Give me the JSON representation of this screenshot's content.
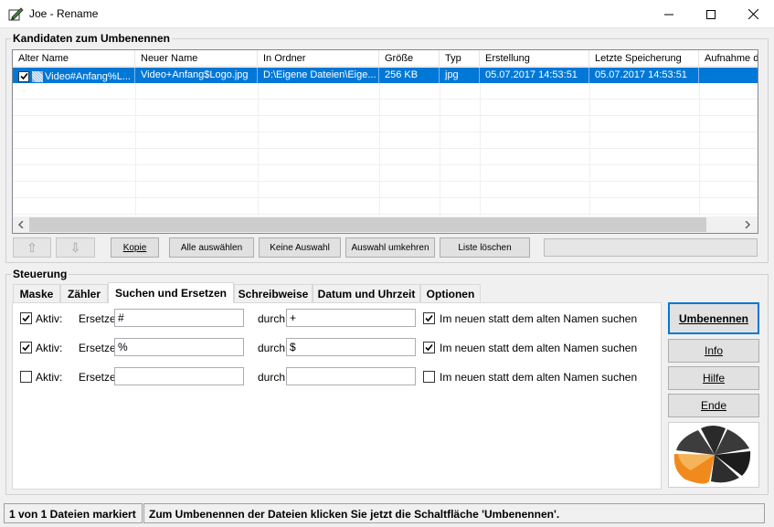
{
  "window": {
    "title": "Joe - Rename"
  },
  "candidates": {
    "group_label": "Kandidaten zum Umbenennen",
    "columns": [
      "Alter Name",
      "Neuer Name",
      "In Ordner",
      "Größe",
      "Typ",
      "Erstellung",
      "Letzte Speicherung",
      "Aufnahme d"
    ],
    "rows": [
      {
        "checked": true,
        "old_name": "Video#Anfang%L...",
        "new_name": "Video+Anfang$Logo.jpg",
        "folder": "D:\\Eigene Dateien\\Eige...",
        "size": "256 KB",
        "type": "jpg",
        "created": "05.07.2017 14:53:51",
        "modified": "05.07.2017 14:53:51",
        "taken": ""
      }
    ]
  },
  "list_buttons": {
    "up": "⇧",
    "down": "⇩",
    "copy": "Kopie",
    "select_all": "Alle auswählen",
    "select_none": "Keine Auswahl",
    "invert": "Auswahl umkehren",
    "clear_list": "Liste löschen"
  },
  "control": {
    "group_label": "Steuerung",
    "tabs": [
      "Maske",
      "Zähler",
      "Suchen und Ersetzen",
      "Schreibweise",
      "Datum und Uhrzeit",
      "Optionen"
    ],
    "active_tab": "Suchen und Ersetzen",
    "rules": [
      {
        "active": true,
        "active_label": "Aktiv:",
        "replace_label": "Ersetze",
        "search": "#",
        "by_label": "durch",
        "replace": "+",
        "use_new_name": true,
        "use_new_label": "Im neuen statt dem alten Namen suchen"
      },
      {
        "active": true,
        "active_label": "Aktiv:",
        "replace_label": "Ersetze",
        "search": "%",
        "by_label": "durch",
        "replace": "$",
        "use_new_name": true,
        "use_new_label": "Im neuen statt dem alten Namen suchen"
      },
      {
        "active": false,
        "active_label": "Aktiv:",
        "replace_label": "Ersetze",
        "search": "",
        "by_label": "durch",
        "replace": "",
        "use_new_name": false,
        "use_new_label": "Im neuen statt dem alten Namen suchen"
      }
    ]
  },
  "actions": {
    "rename": "Umbenennen",
    "info": "Info",
    "help": "Hilfe",
    "end": "Ende"
  },
  "status": {
    "marked": "1 von 1 Dateien markiert",
    "hint": "Zum Umbenennen der Dateien klicken Sie jetzt die Schaltfläche 'Umbenennen'."
  },
  "colors": {
    "selection": "#0078d7",
    "logo_orange": "#f08a1c"
  }
}
